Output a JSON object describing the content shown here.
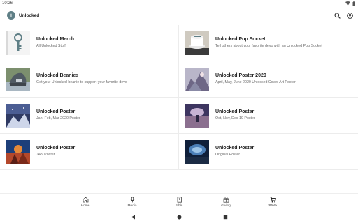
{
  "status_bar": {
    "time": "10:26"
  },
  "app_bar": {
    "title": "Unlocked",
    "logo_glyph": "i"
  },
  "products": [
    {
      "title": "Unlocked Merch",
      "subtitle": "All Unlocked Stuff"
    },
    {
      "title": "Unlocked Pop Socket",
      "subtitle": "Tell others about your favorite devo with an Unlocked Pop Socket"
    },
    {
      "title": "Unlocked Beanies",
      "subtitle": "Get your Unlocked beanie to support your favorite devo"
    },
    {
      "title": "Unlocked Poster 2020",
      "subtitle": "April, May, June 2020 Unlocked Cover Art Poster"
    },
    {
      "title": "Unlocked Poster",
      "subtitle": "Jan, Feb, Mar 2020 Poster"
    },
    {
      "title": "Unlocked Poster",
      "subtitle": "Oct, Nov, Dec 19 Poster"
    },
    {
      "title": "Unlocked Poster",
      "subtitle": "JAS Poster"
    },
    {
      "title": "Unlocked Poster",
      "subtitle": "Original Poster"
    }
  ],
  "bottom_nav": [
    {
      "label": "Home",
      "icon": "home-icon"
    },
    {
      "label": "Media",
      "icon": "microphone-icon"
    },
    {
      "label": "Bible",
      "icon": "book-icon"
    },
    {
      "label": "Giving",
      "icon": "gift-icon"
    },
    {
      "label": "Store",
      "icon": "cart-icon",
      "active": true
    }
  ],
  "colors": {
    "logo": "#5f7f86",
    "divider": "#ececec"
  }
}
